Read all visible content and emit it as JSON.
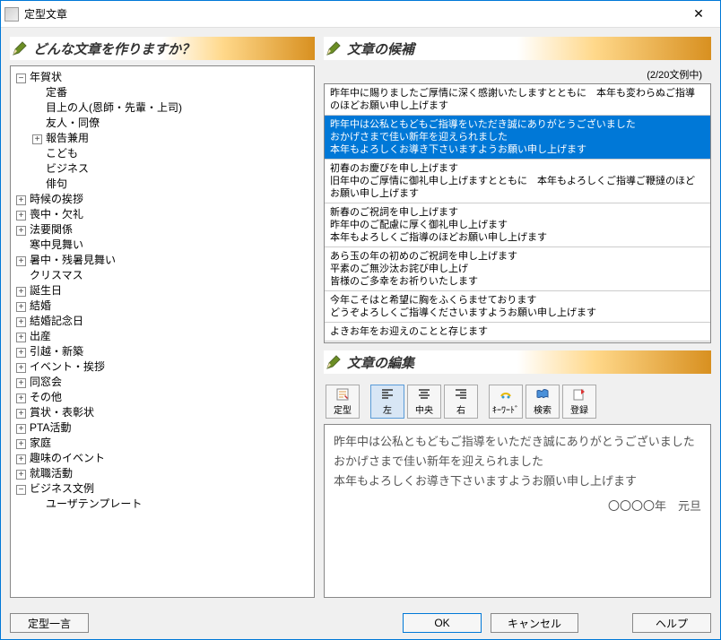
{
  "window": {
    "title": "定型文章",
    "close": "✕"
  },
  "left": {
    "header": "どんな文章を作りますか？",
    "tree": [
      {
        "label": "年賀状",
        "exp": "-",
        "children": [
          {
            "label": "定番"
          },
          {
            "label": "目上の人(恩師・先輩・上司)"
          },
          {
            "label": "友人・同僚"
          },
          {
            "label": "報告兼用",
            "exp": "+"
          },
          {
            "label": "こども"
          },
          {
            "label": "ビジネス"
          },
          {
            "label": "俳句"
          }
        ]
      },
      {
        "label": "時候の挨拶",
        "exp": "+"
      },
      {
        "label": "喪中・欠礼",
        "exp": "+"
      },
      {
        "label": "法要関係",
        "exp": "+"
      },
      {
        "label": "寒中見舞い"
      },
      {
        "label": "暑中・残暑見舞い",
        "exp": "+"
      },
      {
        "label": "クリスマス"
      },
      {
        "label": "誕生日",
        "exp": "+"
      },
      {
        "label": "結婚",
        "exp": "+"
      },
      {
        "label": "結婚記念日",
        "exp": "+"
      },
      {
        "label": "出産",
        "exp": "+"
      },
      {
        "label": "引越・新築",
        "exp": "+"
      },
      {
        "label": "イベント・挨拶",
        "exp": "+"
      },
      {
        "label": "同窓会",
        "exp": "+"
      },
      {
        "label": "その他",
        "exp": "+"
      },
      {
        "label": "賞状・表彰状",
        "exp": "+"
      },
      {
        "label": "PTA活動",
        "exp": "+"
      },
      {
        "label": "家庭",
        "exp": "+"
      },
      {
        "label": "趣味のイベント",
        "exp": "+"
      },
      {
        "label": "就職活動",
        "exp": "+"
      },
      {
        "label": "ビジネス文例",
        "exp": "-",
        "children": [
          {
            "label": "ユーザテンプレート"
          }
        ]
      }
    ]
  },
  "right": {
    "candidates_header": "文章の候補",
    "counter": "(2/20文例中)",
    "candidates": [
      {
        "text": "昨年中に賜りましたご厚情に深く感謝いたしますとともに　本年も変わらぬご指導\nのほどお願い申し上げます",
        "selected": false
      },
      {
        "text": "昨年中は公私ともどもご指導をいただき誠にありがとうございました\nおかげさまで佳い新年を迎えられました\n本年もよろしくお導き下さいますようお願い申し上げます",
        "selected": true
      },
      {
        "text": "初春のお慶びを申し上げます\n旧年中のご厚情に御礼申し上げますとともに　本年もよろしくご指導ご鞭撻のほど\nお願い申し上げます",
        "selected": false
      },
      {
        "text": "新春のご祝詞を申し上げます\n昨年中のご配慮に厚く御礼申し上げます\n本年もよろしくご指導のほどお願い申し上げます",
        "selected": false
      },
      {
        "text": "あら玉の年の初めのご祝詞を申し上げます\n平素のご無沙汰お詫び申し上げ\n皆様のご多幸をお祈りいたします",
        "selected": false
      },
      {
        "text": "今年こそはと希望に胸をふくらませております\nどうぞよろしくご指導くださいますようお願い申し上げます",
        "selected": false
      },
      {
        "text": "よきお年をお迎えのことと存じます",
        "selected": false
      }
    ],
    "editor_header": "文章の編集",
    "toolbar": {
      "teikei": "定型",
      "left": "左",
      "center": "中央",
      "right": "右",
      "keyword": "ｷｰﾜｰﾄﾞ",
      "search": "検索",
      "register": "登録"
    },
    "editor_lines": [
      "昨年中は公私ともどもご指導をいただき誠にありがとうございました",
      "おかげさまで佳い新年を迎えられました",
      "本年もよろしくお導き下さいますようお願い申し上げます"
    ],
    "editor_signature": "〇〇〇〇年　元旦"
  },
  "buttons": {
    "teikei_one": "定型一言",
    "ok": "OK",
    "cancel": "キャンセル",
    "help": "ヘルプ"
  }
}
